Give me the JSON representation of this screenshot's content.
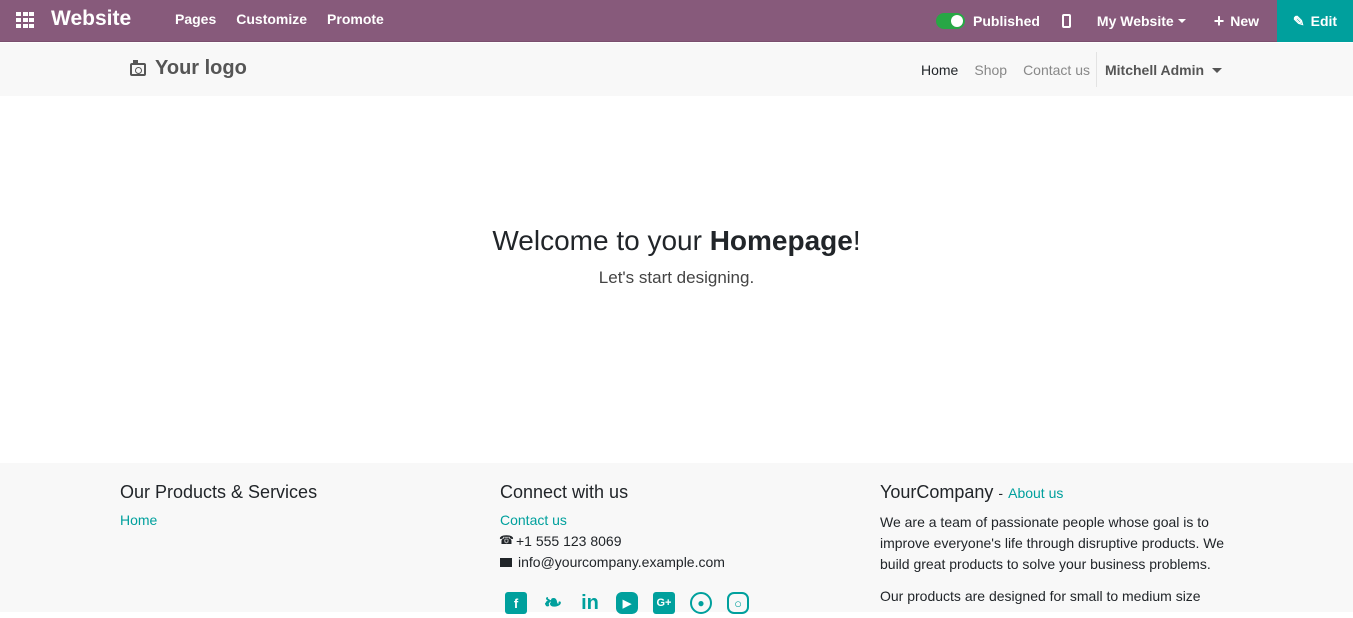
{
  "topbar": {
    "brand": "Website",
    "menu": [
      "Pages",
      "Customize",
      "Promote"
    ],
    "published_label": "Published",
    "my_website_label": "My Website",
    "new_label": "New",
    "edit_label": "Edit",
    "accent_color": "#875a7b",
    "edit_color": "#00a09d"
  },
  "header": {
    "logo_text": "Your logo",
    "nav": [
      "Home",
      "Shop",
      "Contact us"
    ],
    "user": "Mitchell Admin"
  },
  "hero": {
    "title_prefix": "Welcome to your ",
    "title_bold": "Homepage",
    "title_suffix": "!",
    "subtitle": "Let's start designing."
  },
  "footer": {
    "col1": {
      "title": "Our Products & Services",
      "link": "Home"
    },
    "col2": {
      "title": "Connect with us",
      "link": "Contact us",
      "phone": "+1 555 123 8069",
      "email": "info@yourcompany.example.com"
    },
    "col3": {
      "title": "YourCompany",
      "separator": "-",
      "about_link": "About us",
      "para1": "We are a team of passionate people whose goal is to improve everyone's life through disruptive products. We build great products to solve your business problems.",
      "para2": "Our products are designed for small to medium size"
    },
    "social": {
      "facebook": "f",
      "twitter": "❧",
      "linkedin": "in",
      "youtube": "▶",
      "google_plus": "G+",
      "github": "●",
      "instagram": "○"
    }
  }
}
